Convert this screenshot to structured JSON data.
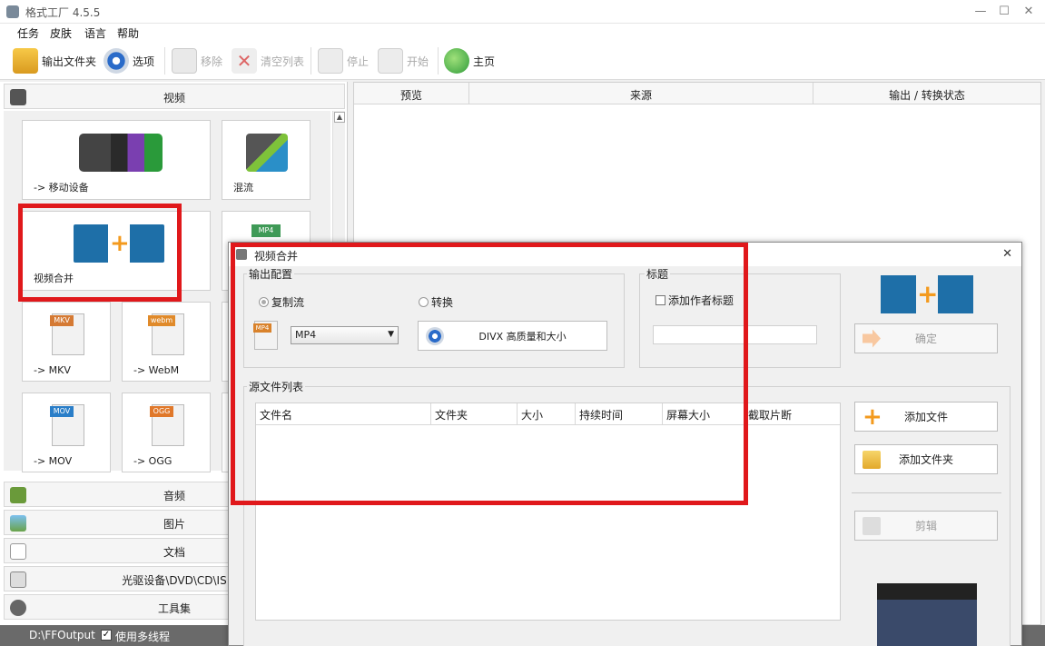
{
  "window": {
    "title": "格式工厂 4.5.5",
    "minimize": "—",
    "maximize": "☐",
    "close": "✕"
  },
  "menu": [
    "任务",
    "皮肤",
    "语言",
    "帮助"
  ],
  "toolbar": {
    "output_folder": "输出文件夹",
    "options": "选项",
    "remove": "移除",
    "clear_list": "清空列表",
    "stop": "停止",
    "start": "开始",
    "home": "主页"
  },
  "left": {
    "video_header": "视频",
    "tiles": {
      "mobile": "-> 移动设备",
      "mux": "混流",
      "merge": "视频合并",
      "mp4_badge": "MP4",
      "mkv": "-> MKV",
      "mkv_badge": "MKV",
      "webm": "-> WebM",
      "webm_badge": "webm",
      "mov": "-> MOV",
      "mov_badge": "MOV",
      "ogg": "-> OGG",
      "ogg_badge": "OGG"
    },
    "categories": [
      "音频",
      "图片",
      "文档",
      "光驱设备\\DVD\\CD\\IS",
      "工具集"
    ],
    "scroll_up": "▲"
  },
  "list": {
    "columns": [
      "预览",
      "来源",
      "输出 / 转换状态"
    ]
  },
  "status": {
    "path": "D:\\FFOutput",
    "check": "✓",
    "multithread": "使用多线程"
  },
  "dialog": {
    "title": "视频合并",
    "close": "✕",
    "output_config": {
      "label": "输出配置",
      "copy_stream": "复制流",
      "convert": "转换",
      "format": "MP4",
      "format_badge": "MP4",
      "preset": "DIVX 高质量和大小"
    },
    "title_group": {
      "label": "标题",
      "add_author": "添加作者标题",
      "title_value": ""
    },
    "ok": "确定",
    "source_list": {
      "label": "源文件列表",
      "columns": [
        "文件名",
        "文件夹",
        "大小",
        "持续时间",
        "屏幕大小",
        "截取片断"
      ]
    },
    "add_file": "添加文件",
    "add_folder": "添加文件夹",
    "clip": "剪辑"
  },
  "colors": {
    "highlight": "#e0181b",
    "statusbar": "#6a6a6a"
  }
}
